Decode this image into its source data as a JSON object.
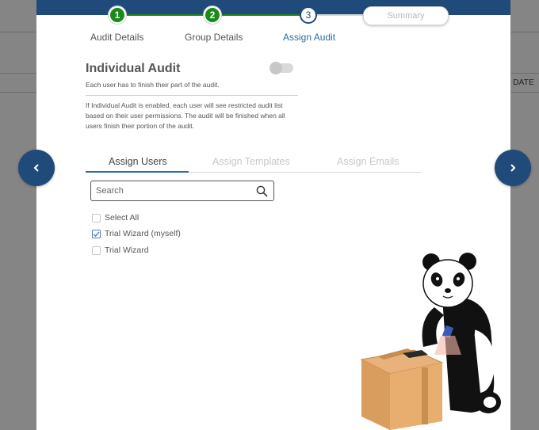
{
  "colors": {
    "brand": "#1f4a7a",
    "done": "#1a8a1a",
    "link": "#2e6da4",
    "overlay": "#858585"
  },
  "background": {
    "column_label": "T DATE"
  },
  "stepper": {
    "steps": [
      {
        "number": "1",
        "label": "Audit Details",
        "state": "done"
      },
      {
        "number": "2",
        "label": "Group Details",
        "state": "done"
      },
      {
        "number": "3",
        "label": "Assign Audit",
        "state": "current"
      }
    ],
    "summary_label": "Summary"
  },
  "individual_audit": {
    "title": "Individual Audit",
    "subtitle": "Each user has to finish their part of the audit.",
    "note": "If Individual Audit is enabled, each user will see restricted audit list based on their user permissions. The audit will be finished when all users finish their portion of the audit.",
    "toggle_on": false
  },
  "tabs": [
    {
      "label": "Assign Users",
      "active": true
    },
    {
      "label": "Assign Templates",
      "active": false
    },
    {
      "label": "Assign Emails",
      "active": false
    }
  ],
  "search": {
    "placeholder": "Search",
    "value": ""
  },
  "users": {
    "select_all_label": "Select All",
    "items": [
      {
        "label": "Trial Wizard (myself)",
        "checked": true
      },
      {
        "label": "Trial Wizard",
        "checked": false
      }
    ]
  },
  "nav": {
    "prev_icon": "chevron-left-icon",
    "next_icon": "chevron-right-icon"
  },
  "illustration": "panda-packing-box"
}
